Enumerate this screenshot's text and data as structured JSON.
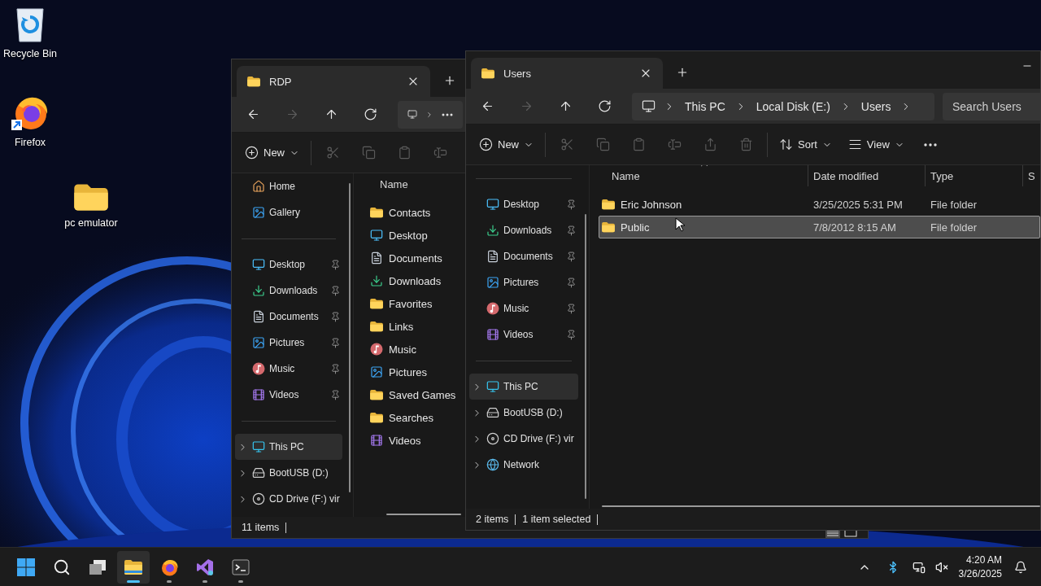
{
  "desktop_icons": [
    {
      "label": "Recycle Bin",
      "kind": "recycle_bin"
    },
    {
      "label": "Firefox",
      "kind": "firefox"
    },
    {
      "label": "pc emulator",
      "kind": "folder"
    }
  ],
  "windows": [
    {
      "tab_title": "RDP",
      "address_overflow": true,
      "toolbar": [
        {
          "kind": "new",
          "label": "New",
          "disabled": false
        },
        {
          "kind": "cut",
          "disabled": true
        },
        {
          "kind": "copy",
          "disabled": true
        },
        {
          "kind": "paste",
          "disabled": true
        },
        {
          "kind": "rename",
          "disabled": true
        }
      ],
      "nav_scrolled": false,
      "nav_groups": [
        {
          "items": [
            {
              "label": "Home",
              "kind": "home",
              "pinned": false,
              "expandable": false,
              "selected": false
            },
            {
              "label": "Gallery",
              "kind": "gallery",
              "pinned": false,
              "expandable": false,
              "selected": false
            }
          ]
        },
        {
          "items": [
            {
              "label": "Desktop",
              "kind": "desktop",
              "pinned": true,
              "expandable": false,
              "selected": false
            },
            {
              "label": "Downloads",
              "kind": "downloads",
              "pinned": true,
              "expandable": false,
              "selected": false
            },
            {
              "label": "Documents",
              "kind": "documents",
              "pinned": true,
              "expandable": false,
              "selected": false
            },
            {
              "label": "Pictures",
              "kind": "pictures",
              "pinned": true,
              "expandable": false,
              "selected": false
            },
            {
              "label": "Music",
              "kind": "music",
              "pinned": true,
              "expandable": false,
              "selected": false
            },
            {
              "label": "Videos",
              "kind": "videos",
              "pinned": true,
              "expandable": false,
              "selected": false
            }
          ]
        },
        {
          "items": [
            {
              "label": "This PC",
              "kind": "pc",
              "pinned": false,
              "expandable": true,
              "selected": true
            },
            {
              "label": "BootUSB (D:)",
              "kind": "usb",
              "pinned": false,
              "expandable": true,
              "selected": false
            },
            {
              "label": "CD Drive (F:) vir",
              "kind": "cd",
              "pinned": false,
              "expandable": true,
              "selected": false
            }
          ]
        }
      ],
      "columns": [
        {
          "label": "Name",
          "sorted": false
        }
      ],
      "rows": [
        {
          "name": "Contacts",
          "kind": "folder",
          "selected": false
        },
        {
          "name": "Desktop",
          "kind": "desktop",
          "selected": false
        },
        {
          "name": "Documents",
          "kind": "documents",
          "selected": false
        },
        {
          "name": "Downloads",
          "kind": "downloads",
          "selected": false
        },
        {
          "name": "Favorites",
          "kind": "folder",
          "selected": false
        },
        {
          "name": "Links",
          "kind": "folder",
          "selected": false
        },
        {
          "name": "Music",
          "kind": "music",
          "selected": false
        },
        {
          "name": "Pictures",
          "kind": "pictures",
          "selected": false
        },
        {
          "name": "Saved Games",
          "kind": "folder",
          "selected": false
        },
        {
          "name": "Searches",
          "kind": "folder",
          "selected": false
        },
        {
          "name": "Videos",
          "kind": "videos",
          "selected": false
        }
      ],
      "status": [
        "11 items"
      ]
    },
    {
      "tab_title": "Users",
      "minimize_button": true,
      "address": [
        "This PC",
        "Local Disk (E:)",
        "Users"
      ],
      "search_placeholder": "Search Users",
      "toolbar": [
        {
          "kind": "new",
          "label": "New",
          "disabled": false
        },
        {
          "kind": "cut",
          "disabled": true
        },
        {
          "kind": "copy",
          "disabled": true
        },
        {
          "kind": "paste",
          "disabled": true
        },
        {
          "kind": "rename",
          "disabled": true
        },
        {
          "kind": "share",
          "disabled": true
        },
        {
          "kind": "delete",
          "disabled": true
        },
        {
          "kind": "sort",
          "label": "Sort",
          "disabled": false
        },
        {
          "kind": "view",
          "label": "View",
          "disabled": false
        },
        {
          "kind": "more",
          "disabled": false
        }
      ],
      "nav_scrolled": true,
      "nav_groups": [
        {
          "items": [
            {
              "label": "Desktop",
              "kind": "desktop",
              "pinned": true,
              "expandable": false,
              "selected": false
            },
            {
              "label": "Downloads",
              "kind": "downloads",
              "pinned": true,
              "expandable": false,
              "selected": false
            },
            {
              "label": "Documents",
              "kind": "documents",
              "pinned": true,
              "expandable": false,
              "selected": false
            },
            {
              "label": "Pictures",
              "kind": "pictures",
              "pinned": true,
              "expandable": false,
              "selected": false
            },
            {
              "label": "Music",
              "kind": "music",
              "pinned": true,
              "expandable": false,
              "selected": false
            },
            {
              "label": "Videos",
              "kind": "videos",
              "pinned": true,
              "expandable": false,
              "selected": false
            }
          ]
        },
        {
          "items": [
            {
              "label": "This PC",
              "kind": "pc",
              "pinned": false,
              "expandable": true,
              "selected": true
            },
            {
              "label": "BootUSB (D:)",
              "kind": "usb",
              "pinned": false,
              "expandable": true,
              "selected": false
            },
            {
              "label": "CD Drive (F:) vir",
              "kind": "cd",
              "pinned": false,
              "expandable": true,
              "selected": false
            },
            {
              "label": "Network",
              "kind": "network",
              "pinned": false,
              "expandable": true,
              "selected": false
            }
          ]
        }
      ],
      "columns": [
        {
          "label": "Name",
          "sorted": true
        },
        {
          "label": "Date modified",
          "sorted": false
        },
        {
          "label": "Type",
          "sorted": false
        },
        {
          "label": "S",
          "sorted": false
        }
      ],
      "rows": [
        {
          "name": "Eric Johnson",
          "date": "3/25/2025 5:31 PM",
          "type": "File folder",
          "kind": "folder",
          "selected": false
        },
        {
          "name": "Public",
          "date": "7/8/2012 8:15 AM",
          "type": "File folder",
          "kind": "folder",
          "selected": true
        }
      ],
      "status": [
        "2 items",
        "1 item selected"
      ]
    }
  ],
  "taskbar": {
    "apps": [
      {
        "kind": "start",
        "selected": false,
        "running": false
      },
      {
        "kind": "search",
        "selected": false,
        "running": false
      },
      {
        "kind": "task_view",
        "selected": false,
        "running": false
      },
      {
        "kind": "explorer",
        "selected": true,
        "running": true
      },
      {
        "kind": "firefox",
        "selected": false,
        "running": true
      },
      {
        "kind": "visual_studio",
        "selected": false,
        "running": true
      },
      {
        "kind": "terminal",
        "selected": false,
        "running": true
      }
    ],
    "time": "4:20 AM",
    "date": "3/26/2025"
  }
}
